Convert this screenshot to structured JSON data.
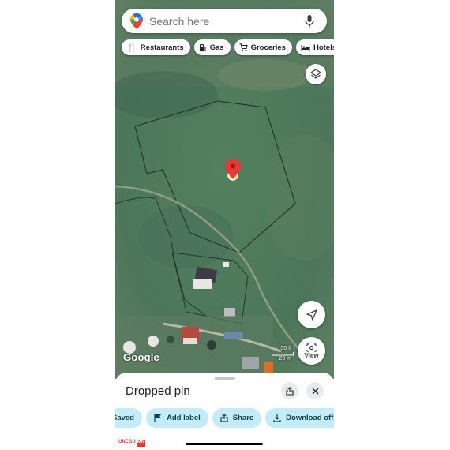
{
  "search": {
    "placeholder": "Search here"
  },
  "chips": [
    {
      "icon": "restaurant-icon",
      "label": "Restaurants"
    },
    {
      "icon": "gas-station-icon",
      "label": "Gas"
    },
    {
      "icon": "cart-icon",
      "label": "Groceries"
    },
    {
      "icon": "bed-icon",
      "label": "Hotels"
    }
  ],
  "map": {
    "attribution": "Google",
    "scale_ft": "50 ft",
    "scale_m": "20 m",
    "view_label": "View",
    "pin_color": "#e53935"
  },
  "sheet": {
    "title": "Dropped pin",
    "actions": [
      {
        "icon": "bookmark-icon",
        "label": "Saved"
      },
      {
        "icon": "flag-icon",
        "label": "Add label"
      },
      {
        "icon": "share-icon",
        "label": "Share"
      },
      {
        "icon": "download-icon",
        "label": "Download offline map"
      }
    ]
  },
  "watermark": {
    "part1": "UNEGU",
    "part2": "MN"
  },
  "colors": {
    "action_bg": "#c3ecf6",
    "map_green": "#4f7a5c"
  }
}
